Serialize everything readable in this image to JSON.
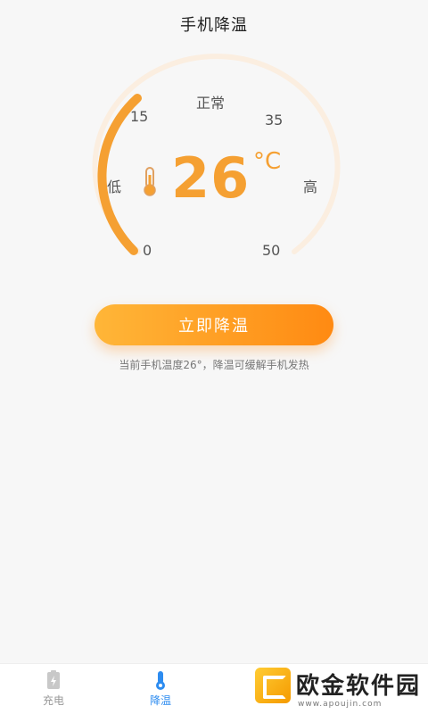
{
  "header": {
    "title": "手机降温"
  },
  "gauge": {
    "status_label": "正常",
    "low_label": "低",
    "high_label": "高",
    "ticks": [
      "0",
      "15",
      "35",
      "50"
    ],
    "temperature": "26",
    "unit": "°C",
    "min": 0,
    "max": 50,
    "accent_color": "#f5a032",
    "track_color": "#fbeee0"
  },
  "action": {
    "button_label": "立即降温",
    "hint": "当前手机温度26°，降温可缓解手机发热"
  },
  "tabbar": {
    "tabs": [
      {
        "label": "充电",
        "icon": "battery-charge-icon",
        "active": false
      },
      {
        "label": "降温",
        "icon": "thermometer-icon",
        "active": true
      }
    ]
  },
  "watermark": {
    "text": "欧金软件园",
    "url": "www.apoujin.com"
  },
  "colors": {
    "tab_active": "#2d8cf0",
    "tab_inactive": "#999999"
  }
}
